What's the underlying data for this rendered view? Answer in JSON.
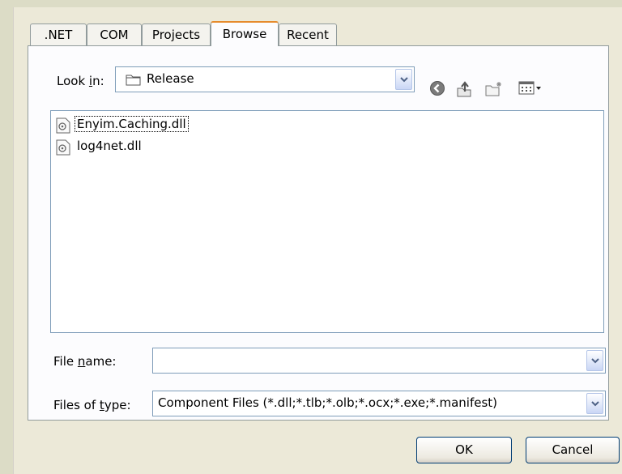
{
  "tabs": [
    {
      "label": ".NET"
    },
    {
      "label": "COM"
    },
    {
      "label": "Projects"
    },
    {
      "label": "Browse"
    },
    {
      "label": "Recent"
    }
  ],
  "active_tab": "Browse",
  "lookin": {
    "label_prefix": "Look ",
    "label_mnemonic": "i",
    "label_suffix": "n:",
    "value": "Release"
  },
  "toolbar": {
    "back_icon": "back-icon",
    "up_icon": "up-folder-icon",
    "new_folder_icon": "new-folder-icon",
    "views_icon": "views-menu-icon"
  },
  "files": [
    {
      "name": "Enyim.Caching.dll",
      "icon": "dll-file-icon",
      "selected": true
    },
    {
      "name": "log4net.dll",
      "icon": "dll-file-icon",
      "selected": false
    }
  ],
  "filename": {
    "label_prefix": "File ",
    "label_mnemonic": "n",
    "label_suffix": "ame:",
    "value": ""
  },
  "filetype": {
    "label_prefix": "Files of ",
    "label_mnemonic": "t",
    "label_suffix": "ype:",
    "value": "Component Files (*.dll;*.tlb;*.olb;*.ocx;*.exe;*.manifest)"
  },
  "buttons": {
    "ok": "OK",
    "cancel": "Cancel"
  },
  "colors": {
    "dialog_bg": "#ece9d8",
    "panel_bg": "#fcfcfe",
    "field_border": "#7f9db9",
    "active_tab_accent": "#e68b2c",
    "button_border": "#003c74"
  }
}
